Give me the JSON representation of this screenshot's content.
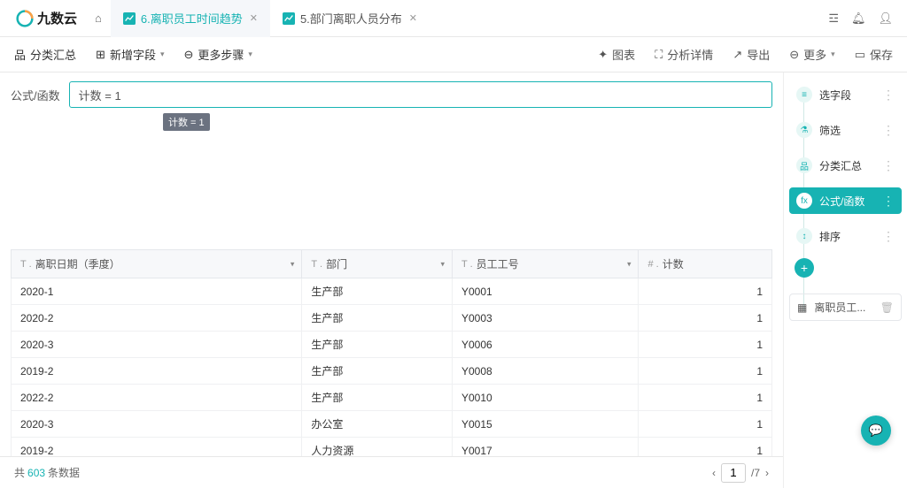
{
  "brand": {
    "name": "九数云"
  },
  "tabs": [
    {
      "label": "6.离职员工时间趋势",
      "active": true
    },
    {
      "label": "5.部门离职人员分布",
      "active": false
    }
  ],
  "toolbar": {
    "group": "分类汇总",
    "add_field": "新增字段",
    "more_steps": "更多步骤",
    "chart": "图表",
    "analysis": "分析详情",
    "export": "导出",
    "more": "更多",
    "save": "保存"
  },
  "formula": {
    "label": "公式/函数",
    "value": "计数 = 1",
    "tip": "计数 = 1"
  },
  "table": {
    "columns": [
      {
        "type": "T",
        "label": "离职日期（季度）"
      },
      {
        "type": "T",
        "label": "部门"
      },
      {
        "type": "T",
        "label": "员工工号"
      },
      {
        "type": "#",
        "label": "计数"
      }
    ],
    "rows": [
      {
        "c0": "2020-1",
        "c1": "生产部",
        "c2": "Y0001",
        "c3": "1"
      },
      {
        "c0": "2020-2",
        "c1": "生产部",
        "c2": "Y0003",
        "c3": "1"
      },
      {
        "c0": "2020-3",
        "c1": "生产部",
        "c2": "Y0006",
        "c3": "1"
      },
      {
        "c0": "2019-2",
        "c1": "生产部",
        "c2": "Y0008",
        "c3": "1"
      },
      {
        "c0": "2022-2",
        "c1": "生产部",
        "c2": "Y0010",
        "c3": "1"
      },
      {
        "c0": "2020-3",
        "c1": "办公室",
        "c2": "Y0015",
        "c3": "1"
      },
      {
        "c0": "2019-2",
        "c1": "人力资源",
        "c2": "Y0017",
        "c3": "1"
      }
    ]
  },
  "pager": {
    "prefix": "共",
    "count": "603",
    "suffix": "条数据",
    "page": "1",
    "total": "/7"
  },
  "steps": [
    {
      "ico": "≡",
      "label": "选字段"
    },
    {
      "ico": "⚗",
      "label": "筛选"
    },
    {
      "ico": "品",
      "label": "分类汇总"
    },
    {
      "ico": "fx",
      "label": "公式/函数",
      "active": true
    },
    {
      "ico": "↕",
      "label": "排序"
    }
  ],
  "output": {
    "label": "离职员工..."
  }
}
